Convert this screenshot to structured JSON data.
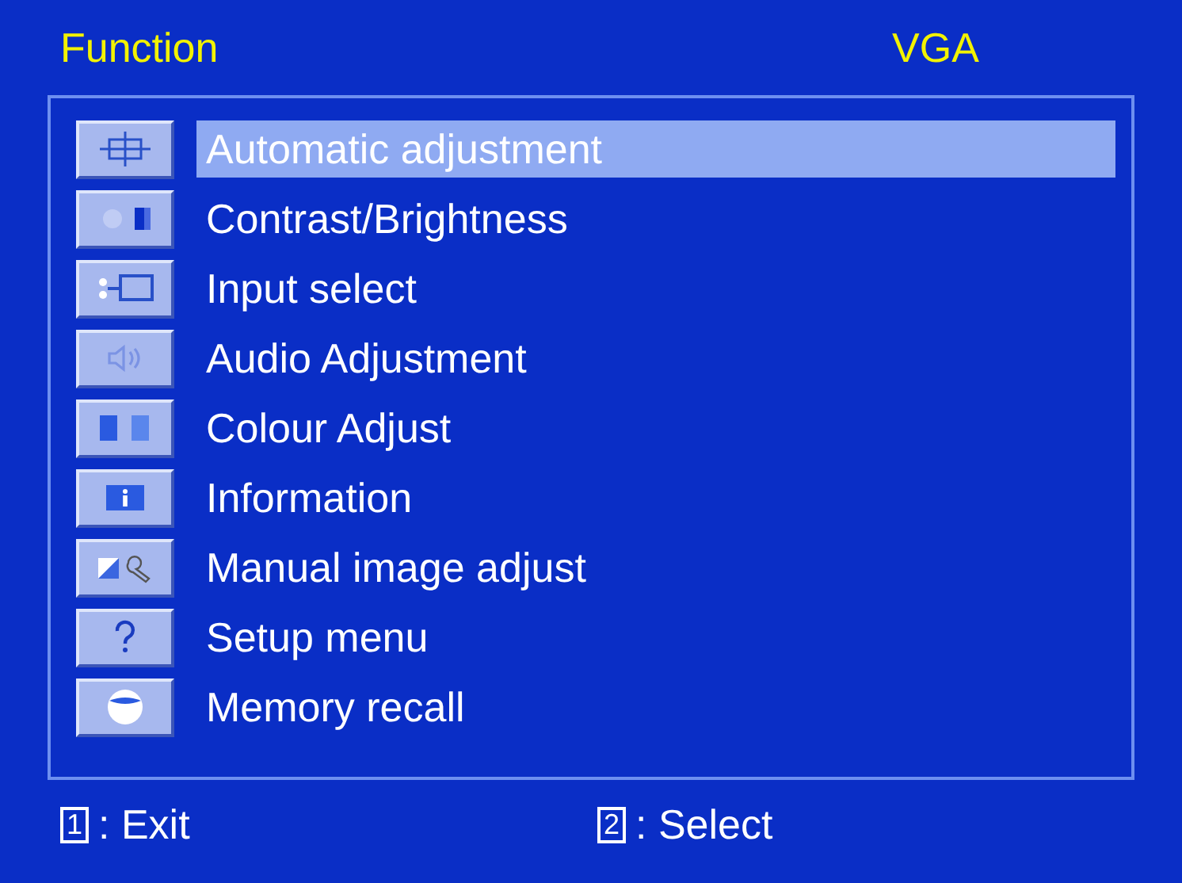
{
  "header": {
    "title": "Function",
    "source": "VGA"
  },
  "menu": [
    {
      "label": "Automatic adjustment",
      "selected": true
    },
    {
      "label": "Contrast/Brightness",
      "selected": false
    },
    {
      "label": "Input select",
      "selected": false
    },
    {
      "label": "Audio Adjustment",
      "selected": false
    },
    {
      "label": "Colour Adjust",
      "selected": false
    },
    {
      "label": "Information",
      "selected": false
    },
    {
      "label": "Manual image adjust",
      "selected": false
    },
    {
      "label": "Setup menu",
      "selected": false
    },
    {
      "label": "Memory recall",
      "selected": false
    }
  ],
  "footer": [
    {
      "key": "1",
      "label": ": Exit"
    },
    {
      "key": "2",
      "label": ": Select"
    }
  ]
}
